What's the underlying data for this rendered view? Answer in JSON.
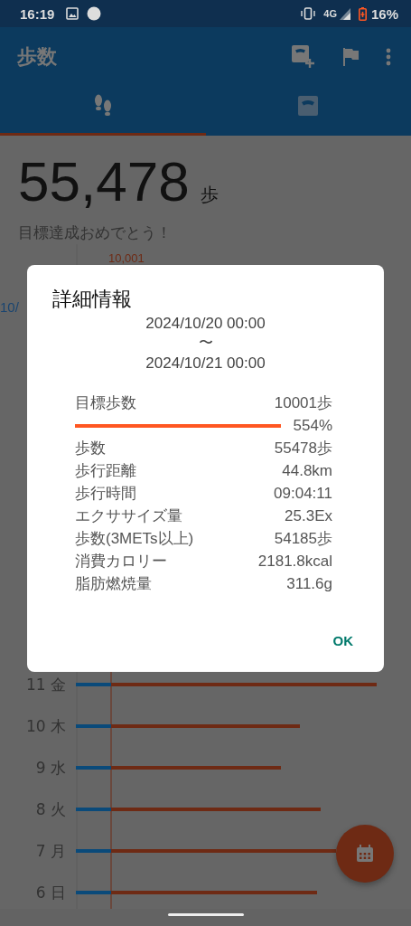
{
  "status_bar": {
    "time": "16:19",
    "network": "4G",
    "battery": "16%"
  },
  "app_bar": {
    "title": "歩数"
  },
  "tabs": [
    {
      "kind": "steps",
      "selected": true
    },
    {
      "kind": "scale",
      "selected": false
    }
  ],
  "summary": {
    "steps": "55,478",
    "unit": "歩",
    "message": "目標達成おめでとう！"
  },
  "chart": {
    "goal_label": "10,001",
    "date_label": "10/",
    "days": [
      "11 金",
      "10 木",
      "9 水",
      "8 火",
      "7 月",
      "6 日"
    ]
  },
  "dialog": {
    "title": "詳細情報",
    "range_start": "2024/10/20 00:00",
    "range_separator": "〜",
    "range_end": "2024/10/21 00:00",
    "goal": {
      "label": "目標歩数",
      "value": "10001歩",
      "percent": "554%"
    },
    "rows": [
      {
        "label": "歩数",
        "value": "55478歩"
      },
      {
        "label": "歩行距離",
        "value": "44.8km"
      },
      {
        "label": "歩行時間",
        "value": "09:04:11"
      },
      {
        "label": "エクササイズ量",
        "value": "25.3Ex"
      },
      {
        "label": "歩数(3METs以上)",
        "value": "54185歩"
      },
      {
        "label": "消費カロリー",
        "value": "2181.8kcal"
      },
      {
        "label": "脂肪燃焼量",
        "value": "311.6g"
      }
    ],
    "button": "OK"
  }
}
